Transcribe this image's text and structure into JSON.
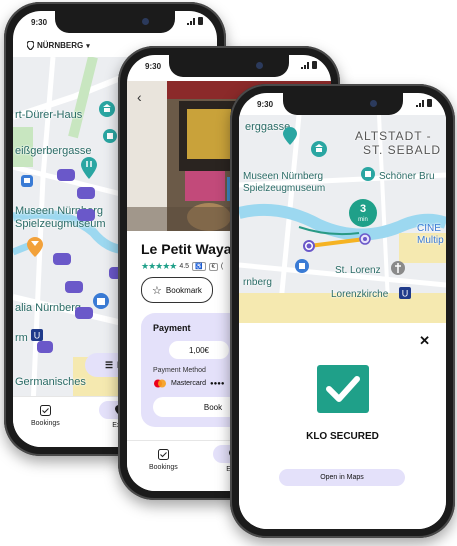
{
  "status": {
    "time": "9:30"
  },
  "phone1": {
    "city": "NÜRNBERG",
    "map_labels": [
      "rt-Dürer-Haus",
      "eißgerbergasse",
      "Museen Nürnberg",
      "Spielzeugmuseum",
      "alia Nürnberg",
      "rm",
      "Germanisches"
    ],
    "list_button": "Li",
    "tabs": [
      "Bookings",
      "Expl"
    ]
  },
  "phone2": {
    "place_name": "Le Petit Waya",
    "rating": "4.5",
    "rating_count": "(",
    "price_badge": "",
    "bookmark_label": "Bookmark",
    "payment": {
      "title": "Payment",
      "amount": "1,00€",
      "method_label": "Payment Method",
      "card_name": "Mastercard",
      "card_mask": "●●●●",
      "book_button": "Book"
    },
    "tabs": [
      "Bookings",
      "Expl"
    ]
  },
  "phone3": {
    "map_labels": {
      "top": "erggasse",
      "district1": "ALTSTADT -",
      "district2": "ST. SEBALD",
      "museum1": "Museen Nürnberg",
      "museum2": "Spielzeugmuseum",
      "shop": "Schöner Bru",
      "cinema1": "CINE",
      "cinema2": "Multip",
      "city": "rnberg",
      "lorenz": "St. Lorenz",
      "lorenzkirche": "Lorenzkirche"
    },
    "route_badge": {
      "value": "3",
      "unit": "min"
    },
    "success_title": "KLO SECURED",
    "open_maps_button": "Open in Maps"
  },
  "colors": {
    "accent": "#1fa089",
    "purple": "#6a58c9",
    "lavender": "#e4e1fa",
    "route": "#f5b323",
    "water": "#9cd8f0",
    "park": "#c8e6c0"
  }
}
